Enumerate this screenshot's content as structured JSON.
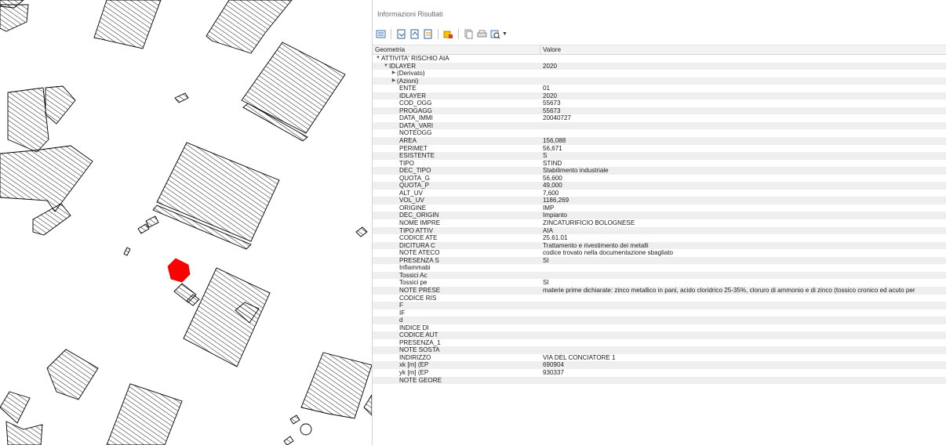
{
  "panel": {
    "title": "Informazioni Risultati",
    "headers": {
      "field": "Geometria",
      "value": "Valore"
    }
  },
  "toolbar": {
    "icons": [
      "expand-tree-icon",
      "collapse-tree-icon",
      "expand-all-icon",
      "collapse-all-icon",
      "highlight-icon",
      "copy-icon",
      "print-icon",
      "identify-mode-icon"
    ]
  },
  "feature": {
    "layer_name": "ATTIVITA' RISCHIO AIA",
    "id_label": "IDLAYER",
    "id_value": "2020",
    "derived_label": "(Derivato)",
    "actions_label": "(Azioni)"
  },
  "attributes": [
    {
      "field": "ENTE",
      "value": "01"
    },
    {
      "field": "IDLAYER",
      "value": "2020"
    },
    {
      "field": "COD_OGG",
      "value": "55673"
    },
    {
      "field": "PROGAGG",
      "value": "55673"
    },
    {
      "field": "DATA_IMMI",
      "value": "20040727"
    },
    {
      "field": "DATA_VARI",
      "value": ""
    },
    {
      "field": "NOTEOGG",
      "value": ""
    },
    {
      "field": "AREA",
      "value": "156,088"
    },
    {
      "field": "PERIMET",
      "value": "56,671"
    },
    {
      "field": "ESISTENTE",
      "value": "S"
    },
    {
      "field": "TIPO",
      "value": "STIND"
    },
    {
      "field": "DEC_TIPO",
      "value": "Stabilimento industriale"
    },
    {
      "field": "QUOTA_G",
      "value": "56,600"
    },
    {
      "field": "QUOTA_P",
      "value": "49,000"
    },
    {
      "field": "ALT_UV",
      "value": "7,600"
    },
    {
      "field": "VOL_UV",
      "value": "1186,269"
    },
    {
      "field": "ORIGINE",
      "value": "IMP"
    },
    {
      "field": "DEC_ORIGIN",
      "value": "Impianto"
    },
    {
      "field": "NOME IMPRE",
      "value": "ZINCATURIFICIO BOLOGNESE"
    },
    {
      "field": "TIPO ATTIV",
      "value": "AIA"
    },
    {
      "field": "CODICE ATE",
      "value": "25.61.01"
    },
    {
      "field": "DICITURA C",
      "value": "Trattamento e rivestimento dei metalli"
    },
    {
      "field": "NOTE ATECO",
      "value": "codice trovato nella documentazione sbagliato"
    },
    {
      "field": "PRESENZA S",
      "value": "SI"
    },
    {
      "field": "Infiammabi",
      "value": ""
    },
    {
      "field": "Tossici Ac",
      "value": ""
    },
    {
      "field": "Tossici pe",
      "value": "SI"
    },
    {
      "field": "NOTE PRESE",
      "value": "materie prime dichiarate: zinco metallico in pani, acido cloridrico 25-35%, cloruro di ammonio e di zinco (tossico cronico ed acuto per"
    },
    {
      "field": "CODICE RIS",
      "value": ""
    },
    {
      "field": "F",
      "value": ""
    },
    {
      "field": "IF",
      "value": ""
    },
    {
      "field": "d",
      "value": ""
    },
    {
      "field": "INDICE DI",
      "value": ""
    },
    {
      "field": "CODICE AUT",
      "value": ""
    },
    {
      "field": "PRESENZA_1",
      "value": ""
    },
    {
      "field": "NOTE SOSTA",
      "value": ""
    },
    {
      "field": "INDIRIZZO",
      "value": "VIA DEL CONCIATORE 1"
    },
    {
      "field": "xk [m] (EP",
      "value": "690904"
    },
    {
      "field": "yk [m] (EP",
      "value": "930337"
    },
    {
      "field": "NOTE GEORE",
      "value": ""
    }
  ],
  "colors": {
    "selected_feature": "#ff0000",
    "building_hatch": "#000000",
    "alt_row": "#efefef"
  }
}
